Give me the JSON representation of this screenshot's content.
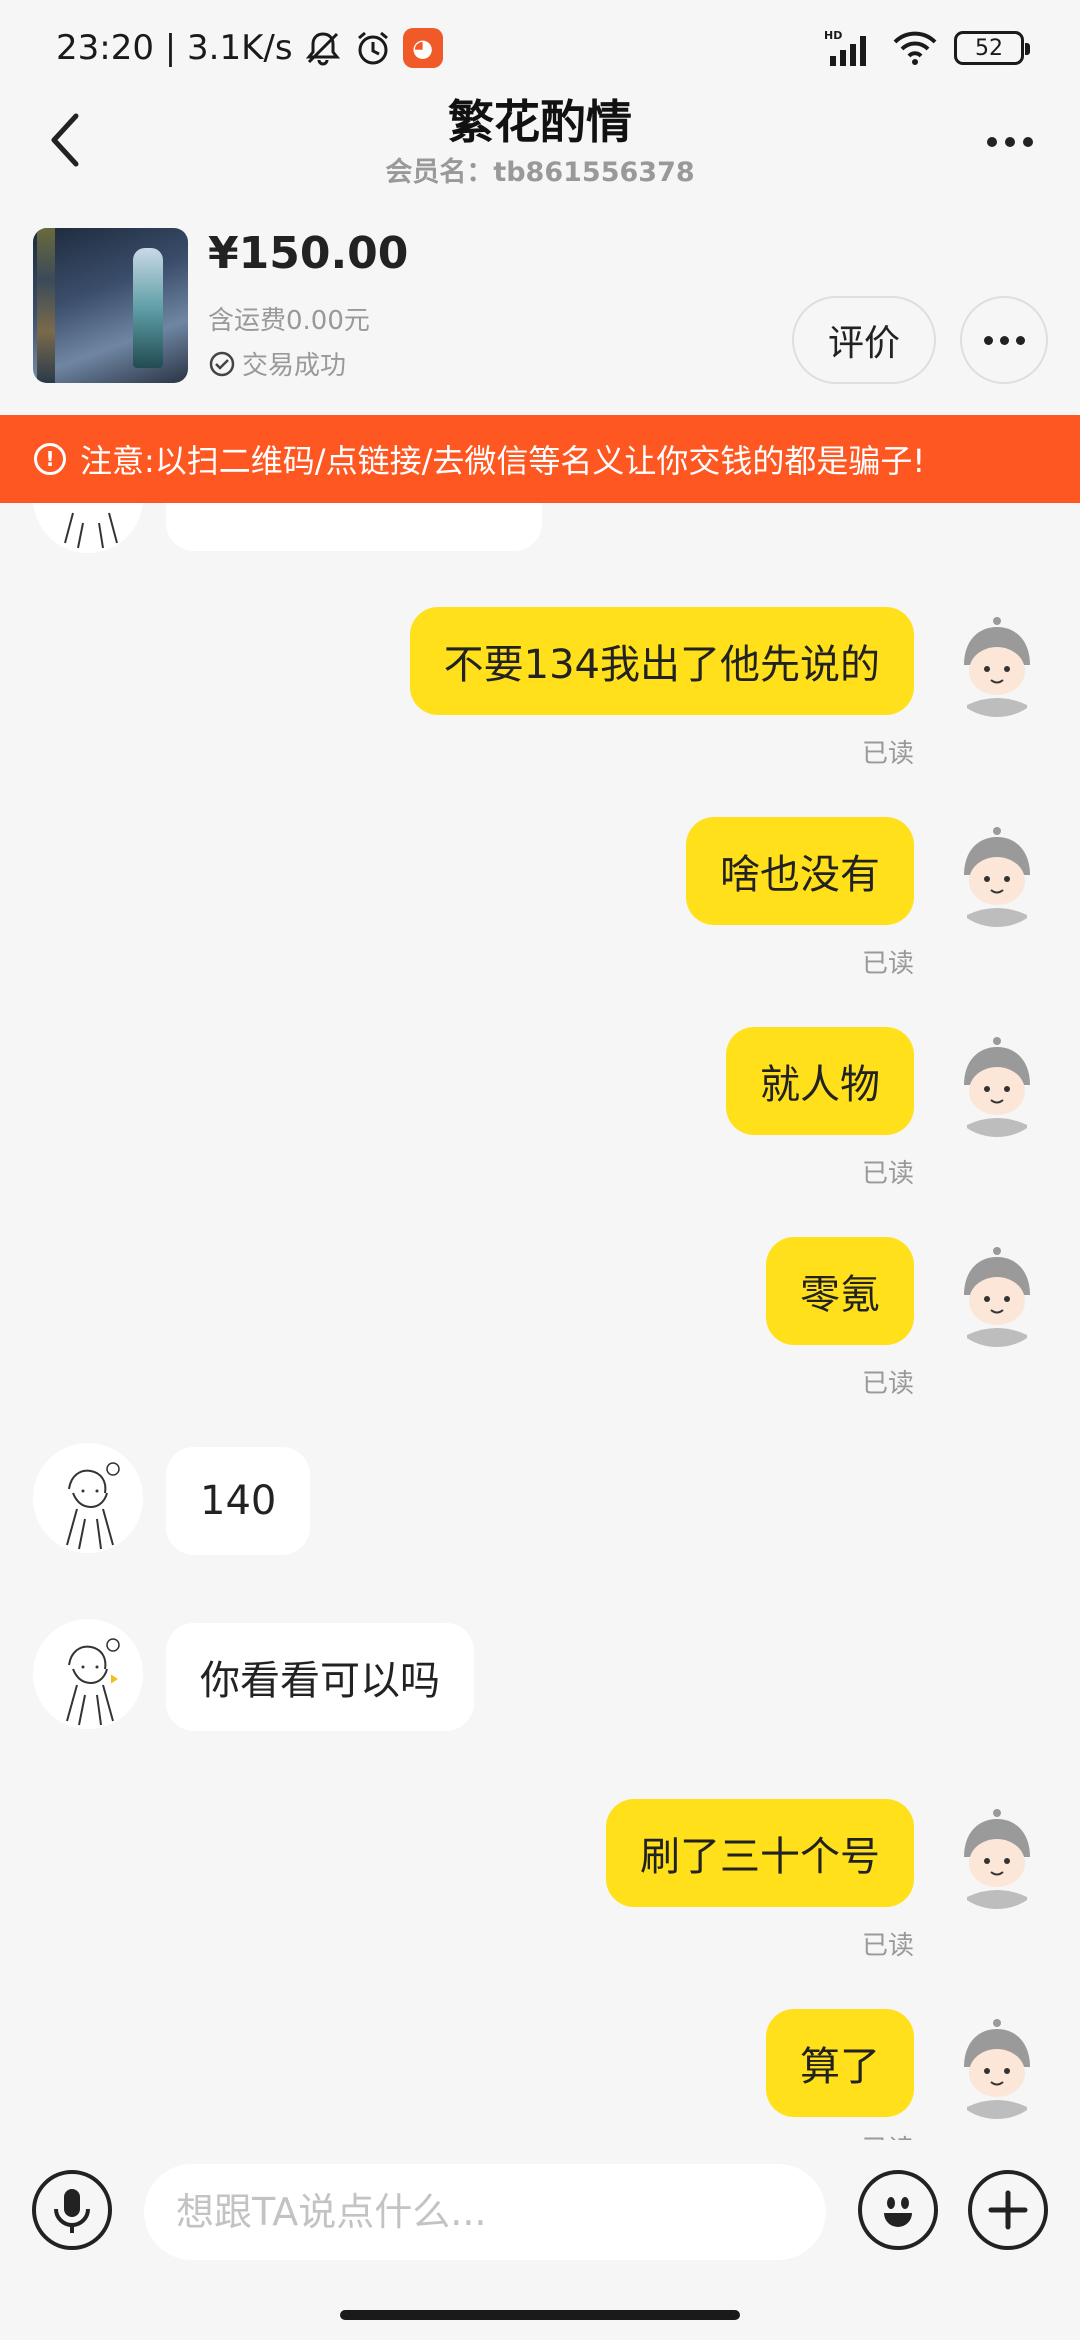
{
  "status_bar": {
    "time_speed": "23:20 | 3.1K/s",
    "battery": "52"
  },
  "header": {
    "title": "繁花酌情",
    "subtitle": "会员名：tb861556378"
  },
  "product": {
    "price": "¥150.00",
    "shipping": "含运费0.00元",
    "status": "交易成功",
    "review_label": "评价"
  },
  "warning": {
    "text": "注意:以扫二维码/点链接/去微信等名义让你交钱的都是骗子!"
  },
  "messages": [
    {
      "side": "me",
      "text": "不要134我出了他先说的",
      "read": "已读"
    },
    {
      "side": "me",
      "text": "啥也没有",
      "read": "已读"
    },
    {
      "side": "me",
      "text": "就人物",
      "read": "已读"
    },
    {
      "side": "me",
      "text": "零氪",
      "read": "已读"
    },
    {
      "side": "them",
      "text": "140"
    },
    {
      "side": "them",
      "text": "你看看可以吗"
    },
    {
      "side": "me",
      "text": "刷了三十个号",
      "read": "已读"
    },
    {
      "side": "me",
      "text": "算了",
      "read": "已读"
    }
  ],
  "input": {
    "placeholder": "想跟TA说点什么..."
  },
  "icons": {
    "back": "chevron-left-icon",
    "more": "more-horizontal-icon",
    "voice": "microphone-icon",
    "emoji": "emoji-icon",
    "plus": "plus-icon",
    "warning": "exclamation-circle-icon",
    "check": "check-circle-icon"
  },
  "colors": {
    "accent_bubble": "#ffe01b",
    "warning_bg": "#ff5722"
  }
}
